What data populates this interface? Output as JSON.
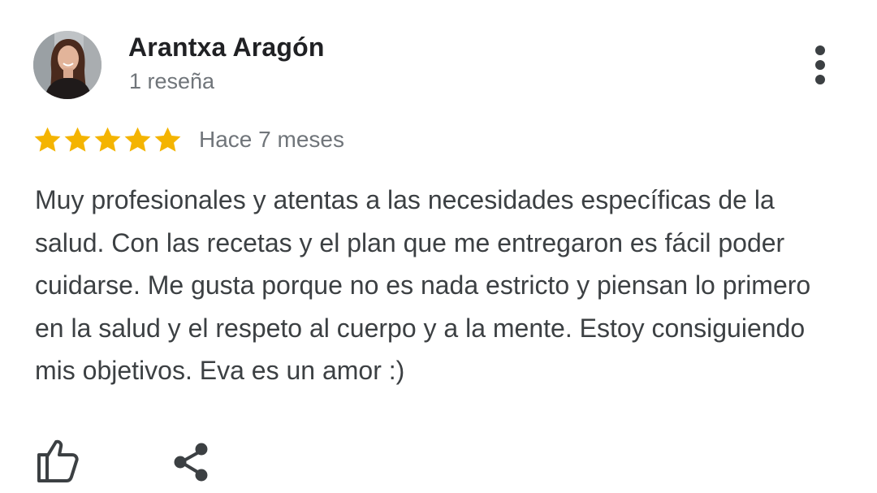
{
  "reviewer": {
    "name": "Arantxa Aragón",
    "review_count": "1 reseña",
    "avatar_icon": "user-photo"
  },
  "menu": {
    "icon": "more-vert-icon"
  },
  "rating": {
    "stars": 5,
    "max_stars": 5,
    "star_color": "#f4b400",
    "time_ago": "Hace 7 meses"
  },
  "review": {
    "text": "Muy profesionales y atentas a las necesidades específicas de la salud. Con las recetas y el plan que me entregaron es fácil poder cuidarse. Me gusta porque no es nada estricto y piensan lo primero en la salud y el respeto al cuerpo y a la mente. Estoy consiguiendo mis objetivos. Eva es un amor :)"
  },
  "actions": {
    "like_icon": "thumb-up-icon",
    "share_icon": "share-icon"
  },
  "colors": {
    "primary_text": "#202124",
    "secondary_text": "#70757a",
    "body_text": "#3c4043",
    "icon": "#3c4043"
  }
}
